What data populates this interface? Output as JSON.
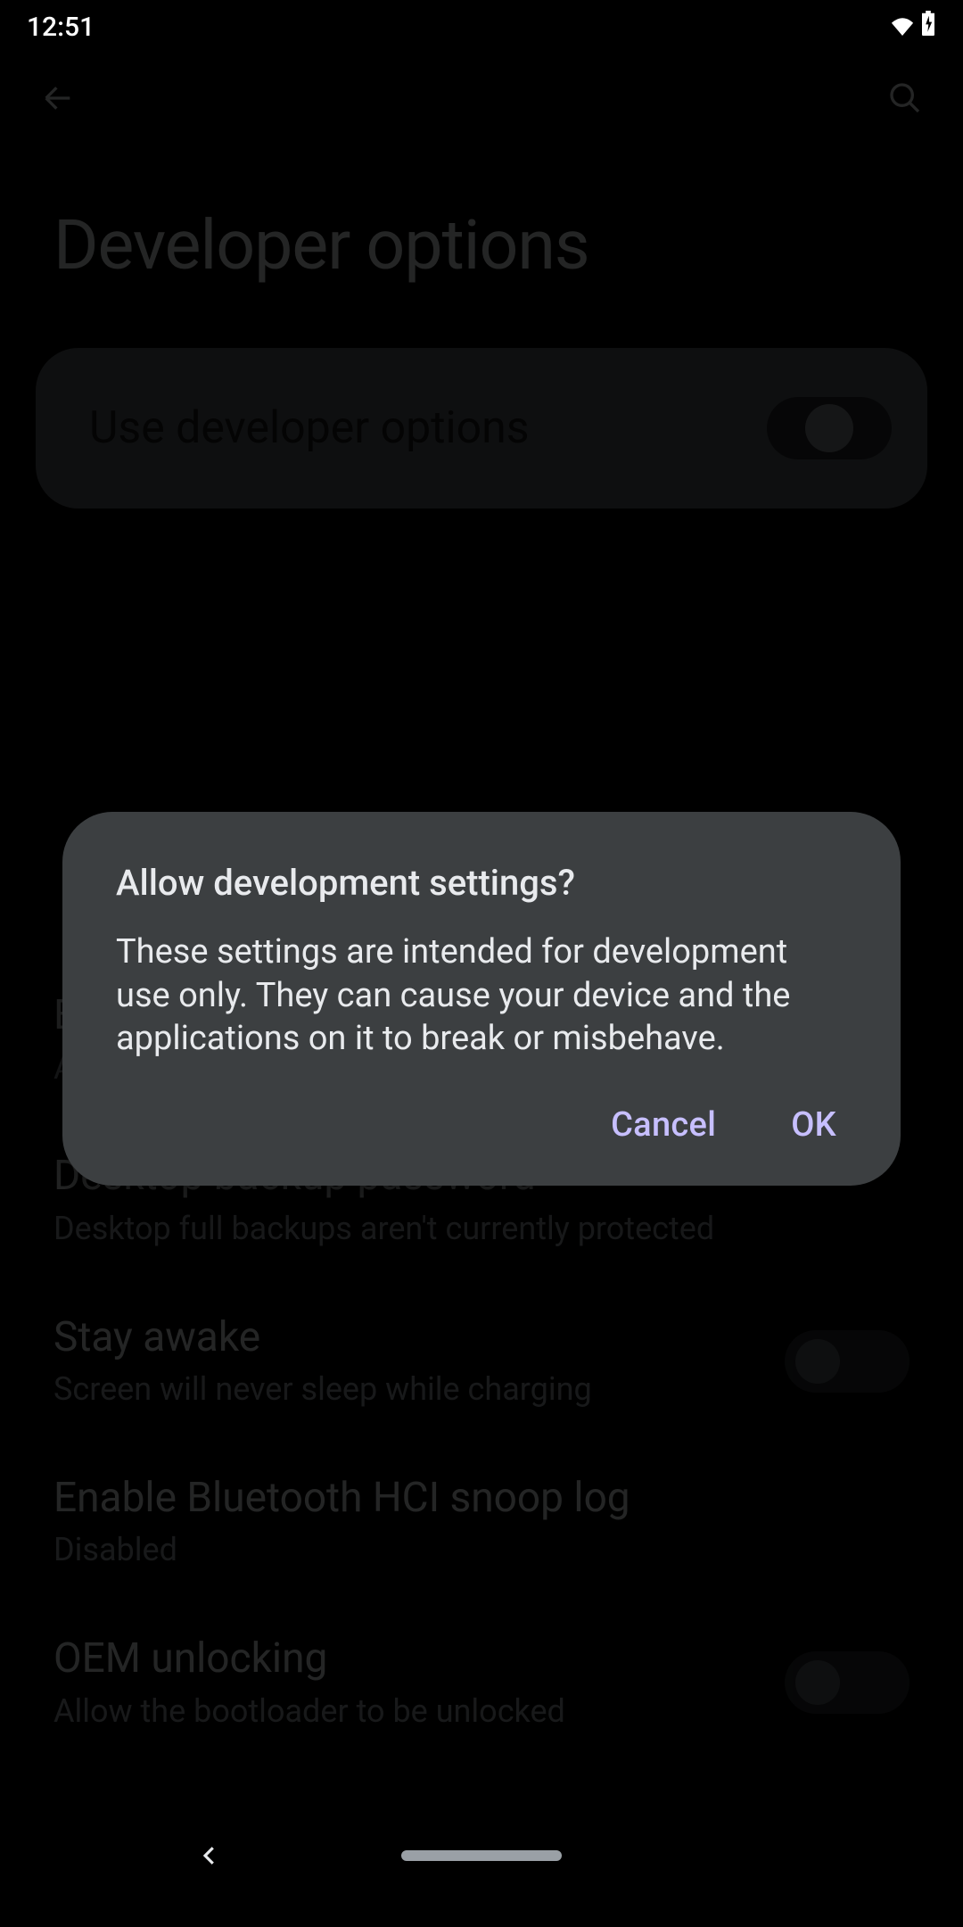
{
  "status_bar": {
    "time": "12:51"
  },
  "toolbar": {},
  "page_title": "Developer options",
  "master_toggle": {
    "label": "Use developer options"
  },
  "settings": {
    "bug_report_handler": {
      "title": "Bug report handler",
      "subtitle": "Android System"
    },
    "desktop_backup_password": {
      "title": "Desktop backup password",
      "subtitle": "Desktop full backups aren't currently protected"
    },
    "stay_awake": {
      "title": "Stay awake",
      "subtitle": "Screen will never sleep while charging"
    },
    "bt_hci_snoop": {
      "title": "Enable Bluetooth HCI snoop log",
      "subtitle": "Disabled"
    },
    "oem_unlocking": {
      "title": "OEM unlocking",
      "subtitle": "Allow the bootloader to be unlocked"
    }
  },
  "dialog": {
    "title": "Allow development settings?",
    "body": "These settings are intended for development use only. They can cause your device and the applications on it to break or misbehave.",
    "cancel": "Cancel",
    "ok": "OK"
  }
}
